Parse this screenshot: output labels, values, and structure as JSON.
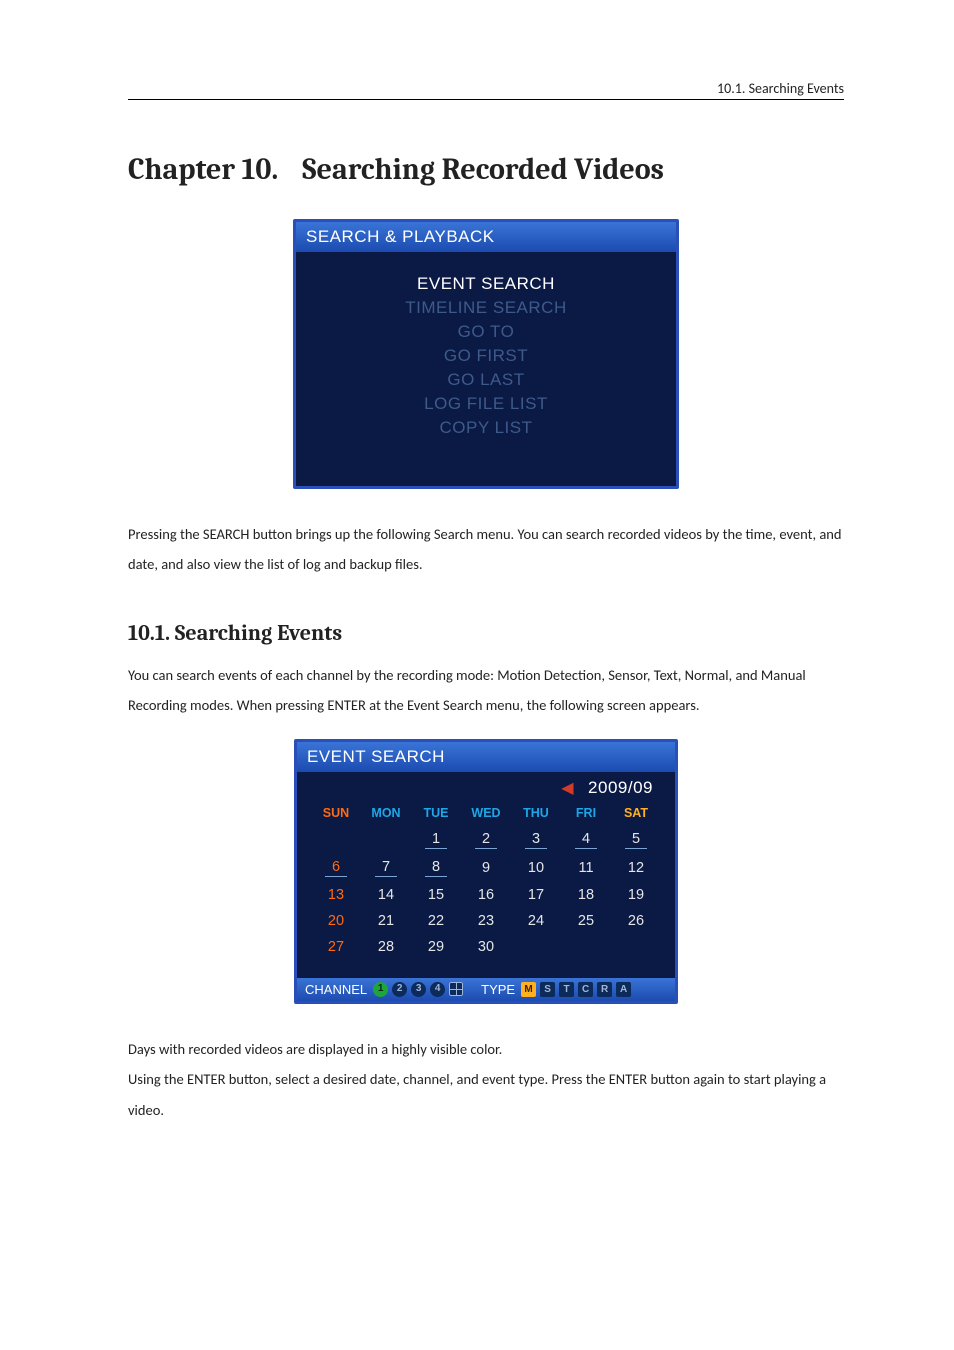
{
  "header": {
    "right": "10.1. Searching Events"
  },
  "chapter": {
    "number": "Chapter 10.",
    "title": "Searching Recorded Videos"
  },
  "searchPanel": {
    "title": "SEARCH & PLAYBACK",
    "items": [
      {
        "label": "EVENT SEARCH",
        "active": true
      },
      {
        "label": "TIMELINE SEARCH",
        "active": false
      },
      {
        "label": "GO TO",
        "active": false
      },
      {
        "label": "GO FIRST",
        "active": false
      },
      {
        "label": "GO LAST",
        "active": false
      },
      {
        "label": "LOG FILE LIST",
        "active": false
      },
      {
        "label": "COPY LIST",
        "active": false
      }
    ]
  },
  "body1": "Pressing the SEARCH button brings up the following Search menu. You can search recorded videos by the time, event, and date, and also view the list of log and backup files.",
  "section": {
    "number": "10.1.",
    "title": "Searching Events"
  },
  "body2": "You can search events of each channel by the recording mode: Motion Detection, Sensor, Text, Normal, and Manual Recording modes. When pressing ENTER at the Event Search menu, the following screen appears.",
  "eventPanel": {
    "title": "EVENT SEARCH",
    "month": "2009/09",
    "weekdays": [
      "SUN",
      "MON",
      "TUE",
      "WED",
      "THU",
      "FRI",
      "SAT"
    ],
    "rows": [
      [
        "",
        "",
        "1",
        "2",
        "3",
        "4",
        "5"
      ],
      [
        "6",
        "7",
        "8",
        "9",
        "10",
        "11",
        "12"
      ],
      [
        "13",
        "14",
        "15",
        "16",
        "17",
        "18",
        "19"
      ],
      [
        "20",
        "21",
        "22",
        "23",
        "24",
        "25",
        "26"
      ],
      [
        "27",
        "28",
        "29",
        "30",
        "",
        "",
        ""
      ]
    ],
    "recorded": [
      "1",
      "2",
      "3",
      "4",
      "5",
      "6",
      "7",
      "8"
    ],
    "bottom": {
      "channelLabel": "CHANNEL",
      "channels": [
        "1",
        "2",
        "3",
        "4"
      ],
      "typeLabel": "TYPE",
      "types": [
        "M",
        "S",
        "T",
        "C",
        "R",
        "A"
      ]
    }
  },
  "body3a": "Days with recorded videos are displayed in a highly visible color.",
  "body3b": "Using the ENTER button, select a desired date, channel, and event type. Press the ENTER button again to start playing a video."
}
